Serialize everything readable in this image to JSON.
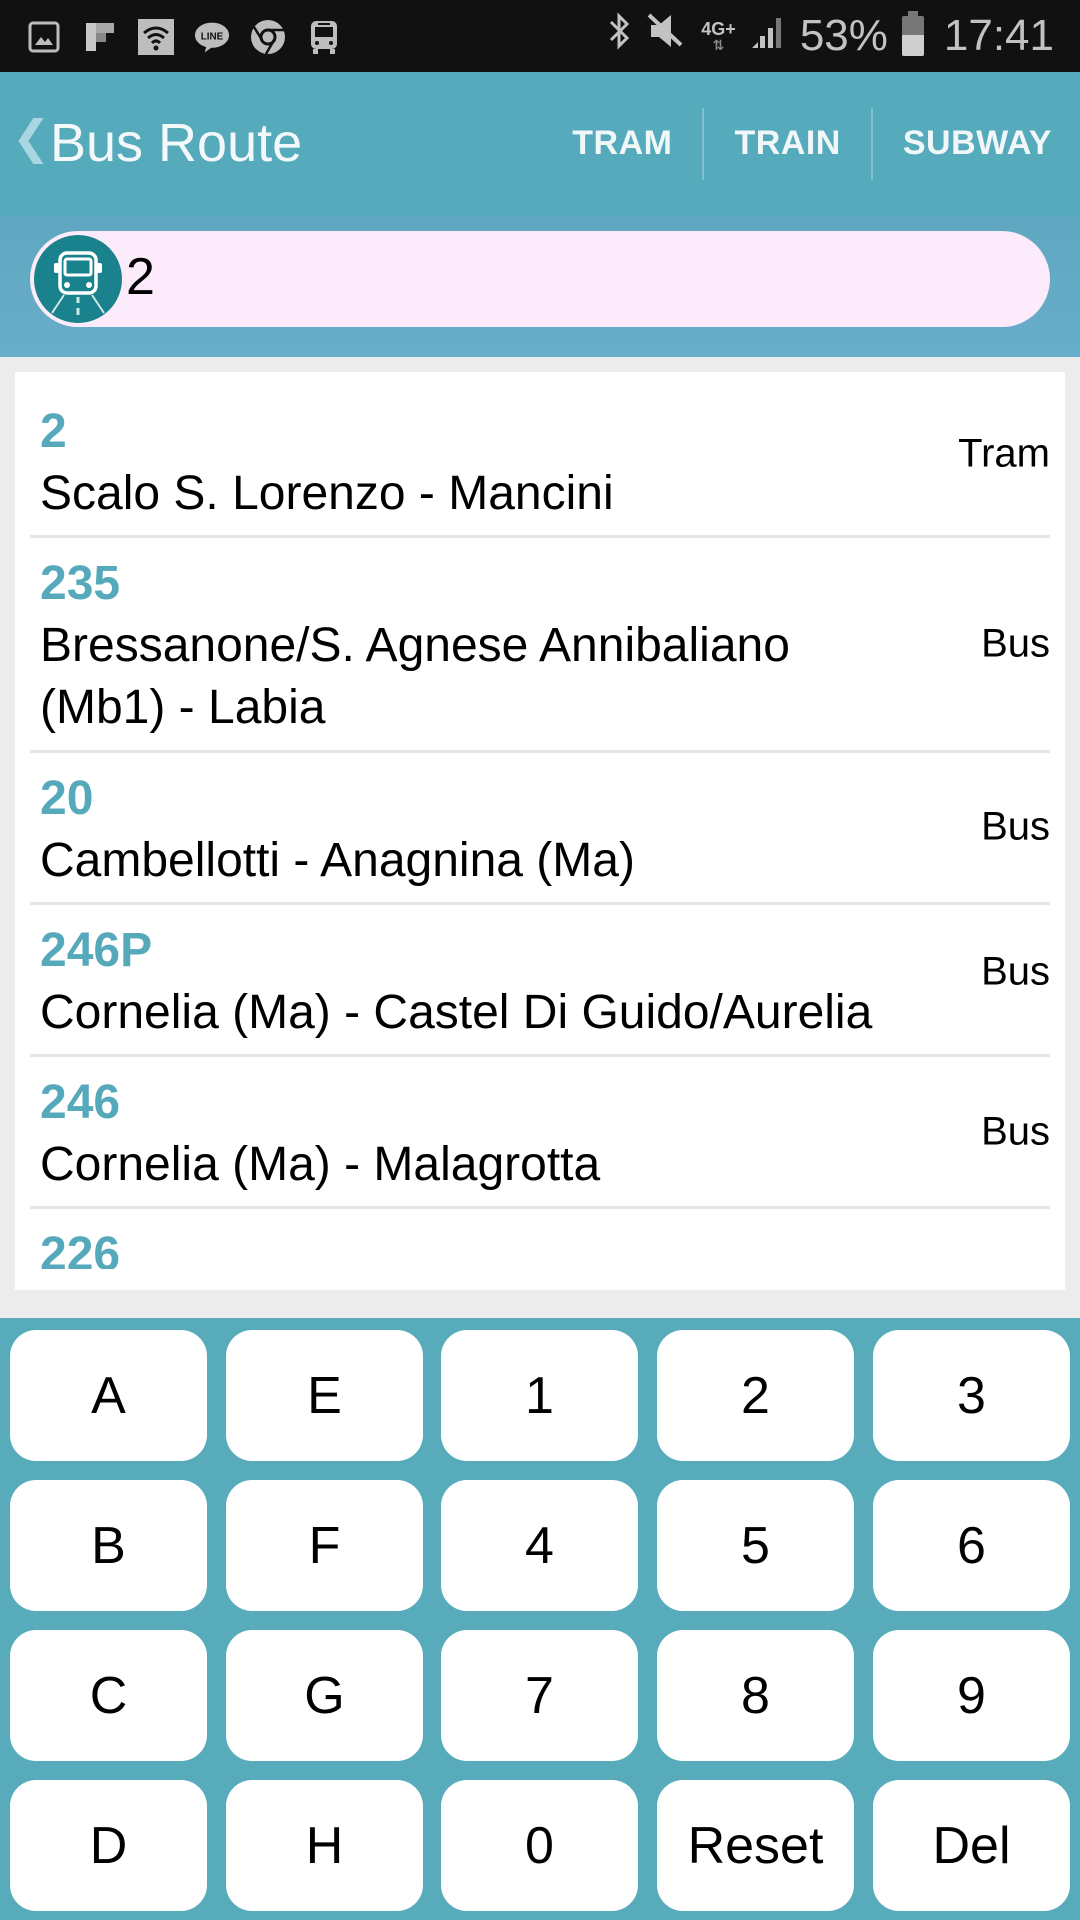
{
  "status_bar": {
    "left_icons": [
      "gallery-icon",
      "flipboard-icon",
      "wifi-icon",
      "line-icon",
      "chrome-icon",
      "bus-icon"
    ],
    "right_icons": [
      "bluetooth-icon",
      "mute-icon",
      "network-4g-icon",
      "signal-icon",
      "battery-icon"
    ],
    "network_label": "4G+",
    "battery_percent": "53%",
    "battery_level": 0.53,
    "time": "17:41"
  },
  "header": {
    "back_glyph": "❮",
    "title": "Bus Route",
    "tabs": [
      {
        "label": "TRAM"
      },
      {
        "label": "TRAIN"
      },
      {
        "label": "SUBWAY"
      }
    ]
  },
  "search": {
    "icon": "bus-icon",
    "value": "2"
  },
  "routes": [
    {
      "number": "2",
      "name": "Scalo S. Lorenzo - Mancini",
      "type": "Tram"
    },
    {
      "number": "235",
      "name": "Bressanone/S. Agnese Annibaliano (Mb1) - Labia",
      "type": "Bus"
    },
    {
      "number": "20",
      "name": "Cambellotti - Anagnina (Ma)",
      "type": "Bus"
    },
    {
      "number": "246P",
      "name": "Cornelia (Ma) - Castel Di Guido/Aurelia",
      "type": "Bus"
    },
    {
      "number": "246",
      "name": "Cornelia (Ma) - Malagrotta",
      "type": "Bus"
    },
    {
      "number": "226",
      "name": "",
      "type": ""
    }
  ],
  "keypad": {
    "keys": [
      [
        "A",
        "E",
        "1",
        "2",
        "3"
      ],
      [
        "B",
        "F",
        "4",
        "5",
        "6"
      ],
      [
        "C",
        "G",
        "7",
        "8",
        "9"
      ],
      [
        "D",
        "H",
        "0",
        "Reset",
        "Del"
      ]
    ]
  },
  "colors": {
    "accent": "#55aabb",
    "status_bar": "#111111",
    "search_bg": "#68aecb",
    "search_pill": "#fcebfa",
    "route_number": "#55a9bb",
    "keypad_bg": "#57abbb"
  }
}
